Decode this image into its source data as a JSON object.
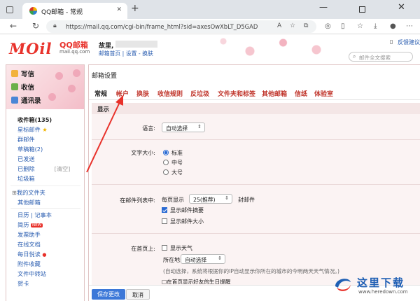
{
  "browser": {
    "tab_title": "QQ邮箱 - 常规",
    "url": "https://mail.qq.com/cgi-bin/frame_html?sid=axesOwXbLT_D5GAD"
  },
  "header": {
    "logo_text": "MOil",
    "logo_cn": "QQ邮箱",
    "logo_domain": "mail.qq.com",
    "user_greeting": "故里,",
    "links": [
      "邮箱首页",
      "设置",
      "换肤"
    ],
    "top_links": [
      "反馈建议"
    ],
    "search_placeholder": "邮件全文搜索"
  },
  "sidebar": {
    "write": "写信",
    "receive": "收信",
    "contacts": "通讯录",
    "folders": [
      {
        "label": "收件箱(135)",
        "bold": true
      },
      {
        "label": "星标邮件",
        "star": true
      },
      {
        "label": "群邮件"
      },
      {
        "label": "草稿箱(2)"
      },
      {
        "label": "已发送"
      },
      {
        "label": "已删除",
        "extra": "[清空]"
      },
      {
        "label": "垃圾箱"
      }
    ],
    "my_folders": "我的文件夹",
    "other_mail": "其他邮箱",
    "apps": [
      {
        "label": "日历 | 记事本"
      },
      {
        "label": "简历",
        "badge": "NEW"
      },
      {
        "label": "发票助手"
      },
      {
        "label": "在线文档"
      },
      {
        "label": "每日悦读",
        "dot": true
      },
      {
        "label": "附件收藏"
      },
      {
        "label": "文件中转站"
      },
      {
        "label": "贺卡"
      }
    ]
  },
  "main": {
    "title": "邮箱设置",
    "tabs": [
      "常规",
      "帐户",
      "换肤",
      "收信规则",
      "反垃圾",
      "文件夹和标签",
      "其他邮箱",
      "信纸",
      "体验室"
    ],
    "active_tab": "常规",
    "section": "显示",
    "language": {
      "label": "语言:",
      "value": "自动选择"
    },
    "font_size": {
      "label": "文字大小:",
      "options": [
        "标准",
        "中号",
        "大号"
      ],
      "selected": "标准"
    },
    "list": {
      "label": "在邮件列表中:",
      "per_page_prefix": "每页显示",
      "per_page_value": "25(推荐)",
      "per_page_suffix": "封邮件",
      "show_summary": "显示邮件摘要",
      "show_summary_checked": true,
      "show_size": "显示邮件大小",
      "show_size_checked": false
    },
    "home": {
      "label": "在首页上:",
      "show_weather": "显示天气",
      "location_label": "所在地:",
      "location_value": "自动选择",
      "note": "(自动选择，系统将根据你的IP自动显示你所在的城市的今明两天天气情况。)",
      "birthday": "□在首页显示好友的生日提醒"
    },
    "save_button": "保存更改",
    "cancel_button": "取消"
  },
  "watermark": {
    "cn": "这里下载",
    "en": "www.heredown.com"
  },
  "colors": {
    "accent": "#c0352b",
    "link": "#2a5db0",
    "primary_button": "#3c78d8",
    "arrow": "#e8322b"
  }
}
